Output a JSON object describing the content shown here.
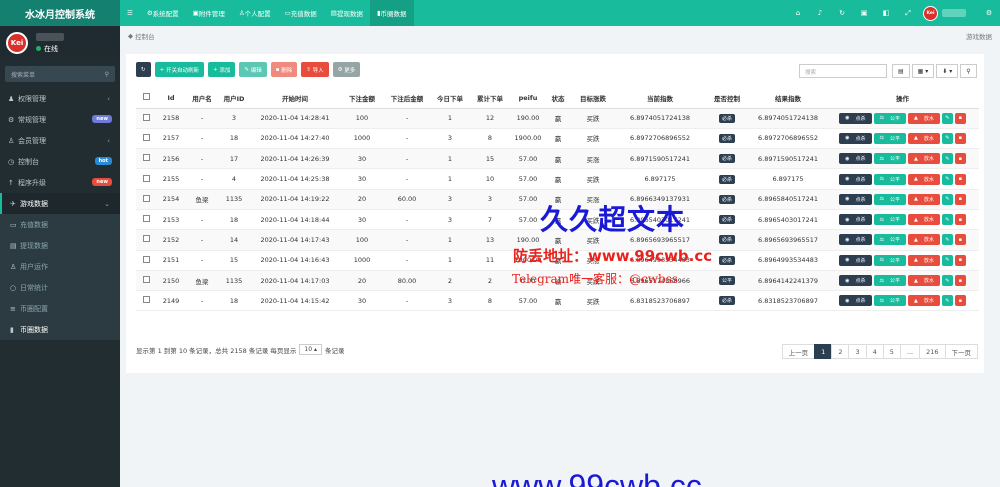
{
  "app": {
    "title": "水冰月控制系统",
    "status": "在线",
    "avatar_text": "Kei"
  },
  "sidebar": {
    "search_placeholder": "搜索菜单",
    "items": [
      {
        "label": "权限管理",
        "icon": "users-icon",
        "badge": "",
        "chev": "‹"
      },
      {
        "label": "常规管理",
        "icon": "cog-icon",
        "badge": "new",
        "badge_color": "#6e7bd9",
        "chev": ""
      },
      {
        "label": "会员管理",
        "icon": "user-icon",
        "badge": "",
        "chev": "‹"
      },
      {
        "label": "控制台",
        "icon": "dashboard-icon",
        "badge": "hot",
        "badge_color": "#2a8ad8",
        "chev": ""
      },
      {
        "label": "程序升级",
        "icon": "upgrade-icon",
        "badge": "new",
        "badge_color": "#e74c3c",
        "chev": ""
      },
      {
        "label": "游戏数据",
        "icon": "gamepad-icon",
        "badge": "",
        "chev": "⌄"
      }
    ],
    "sub": [
      {
        "label": "充值数据",
        "icon": "card-icon"
      },
      {
        "label": "提现数据",
        "icon": "cash-icon"
      },
      {
        "label": "用户运作",
        "icon": "user-icon"
      },
      {
        "label": "日常统计",
        "icon": "circle-icon"
      },
      {
        "label": "币圈配置",
        "icon": "config-icon"
      },
      {
        "label": "币圈数据",
        "icon": "chart-icon"
      }
    ]
  },
  "topnav": {
    "tabs": [
      "系统配置",
      "附件管理",
      "个人配置",
      "充值数据",
      "提现数据",
      "币圈数据"
    ],
    "active": "币圈数据"
  },
  "breadcrumb": {
    "left": "控制台",
    "right": "游戏数据"
  },
  "toolbar": {
    "refresh": "↻",
    "toggle": "开关自动刷新",
    "add": "添加",
    "edit": "编辑",
    "delete": "删除",
    "import": "导入",
    "more": "更多",
    "search_placeholder": "搜索"
  },
  "table": {
    "headers": [
      "Id",
      "用户名",
      "用户ID",
      "开始时间",
      "下注金额",
      "下注后金额",
      "今日下单",
      "累计下单",
      "peifu",
      "状态",
      "目标涨跌",
      "当前指数",
      "是否控制",
      "结果指数",
      "操作"
    ],
    "rows": [
      [
        "2158",
        "-",
        "3",
        "2020-11-04 14:28:41",
        "100",
        "-",
        "1",
        "12",
        "190.00",
        "赢",
        "买跌",
        "6.8974051724138",
        "必杀",
        "6.8974051724138"
      ],
      [
        "2157",
        "-",
        "18",
        "2020-11-04 14:27:40",
        "1000",
        "-",
        "3",
        "8",
        "1900.00",
        "赢",
        "买跌",
        "6.8972706896552",
        "必杀",
        "6.8972706896552"
      ],
      [
        "2156",
        "-",
        "17",
        "2020-11-04 14:26:39",
        "30",
        "-",
        "1",
        "15",
        "57.00",
        "赢",
        "买涨",
        "6.8971590517241",
        "必杀",
        "6.8971590517241"
      ],
      [
        "2155",
        "-",
        "4",
        "2020-11-04 14:25:38",
        "30",
        "-",
        "1",
        "10",
        "57.00",
        "赢",
        "买跌",
        "6.897175",
        "必杀",
        "6.897175"
      ],
      [
        "2154",
        "鱼梁",
        "1135",
        "2020-11-04 14:19:22",
        "20",
        "60.00",
        "3",
        "3",
        "57.00",
        "赢",
        "买涨",
        "6.8966349137931",
        "必杀",
        "6.8965840517241"
      ],
      [
        "2153",
        "-",
        "18",
        "2020-11-04 14:18:44",
        "30",
        "-",
        "3",
        "7",
        "57.00",
        "赢",
        "买跌",
        "6.8965403017241",
        "必杀",
        "6.8965403017241"
      ],
      [
        "2152",
        "-",
        "14",
        "2020-11-04 14:17:43",
        "100",
        "-",
        "1",
        "13",
        "190.00",
        "赢",
        "买跌",
        "6.8965693965517",
        "必杀",
        "6.8965693965517"
      ],
      [
        "2151",
        "-",
        "15",
        "2020-11-04 14:16:43",
        "1000",
        "-",
        "1",
        "11",
        "1900.00",
        "赢",
        "买涨",
        "6.8964993534483",
        "必杀",
        "6.8964993534483"
      ],
      [
        "2150",
        "鱼梁",
        "1135",
        "2020-11-04 14:17:03",
        "20",
        "80.00",
        "2",
        "2",
        "0.00",
        "输",
        "买跌",
        "6.8965174568966",
        "公平",
        "6.8964142241379"
      ],
      [
        "2149",
        "-",
        "18",
        "2020-11-04 14:15:42",
        "30",
        "-",
        "3",
        "8",
        "57.00",
        "赢",
        "买跌",
        "6.8318523706897",
        "必杀",
        "6.8318523706897"
      ]
    ],
    "ops": {
      "kill": "点杀",
      "fair": "公平",
      "release": "放水"
    }
  },
  "footer": {
    "info": "显示第 1 到第 10 条记录，总共 2158 条记录 每页显示",
    "per_page": "10",
    "suffix": "条记录"
  },
  "pager": {
    "prev": "上一页",
    "pages": [
      "1",
      "2",
      "3",
      "4",
      "5",
      "...",
      "216"
    ],
    "next": "下一页",
    "current": "1"
  },
  "watermark": {
    "line1": "久久超文本",
    "line2": "防丢地址：www.99cwb.cc",
    "line3": "Telegram唯一客服：@cwbss",
    "line4": "www.99cwb.cc"
  }
}
